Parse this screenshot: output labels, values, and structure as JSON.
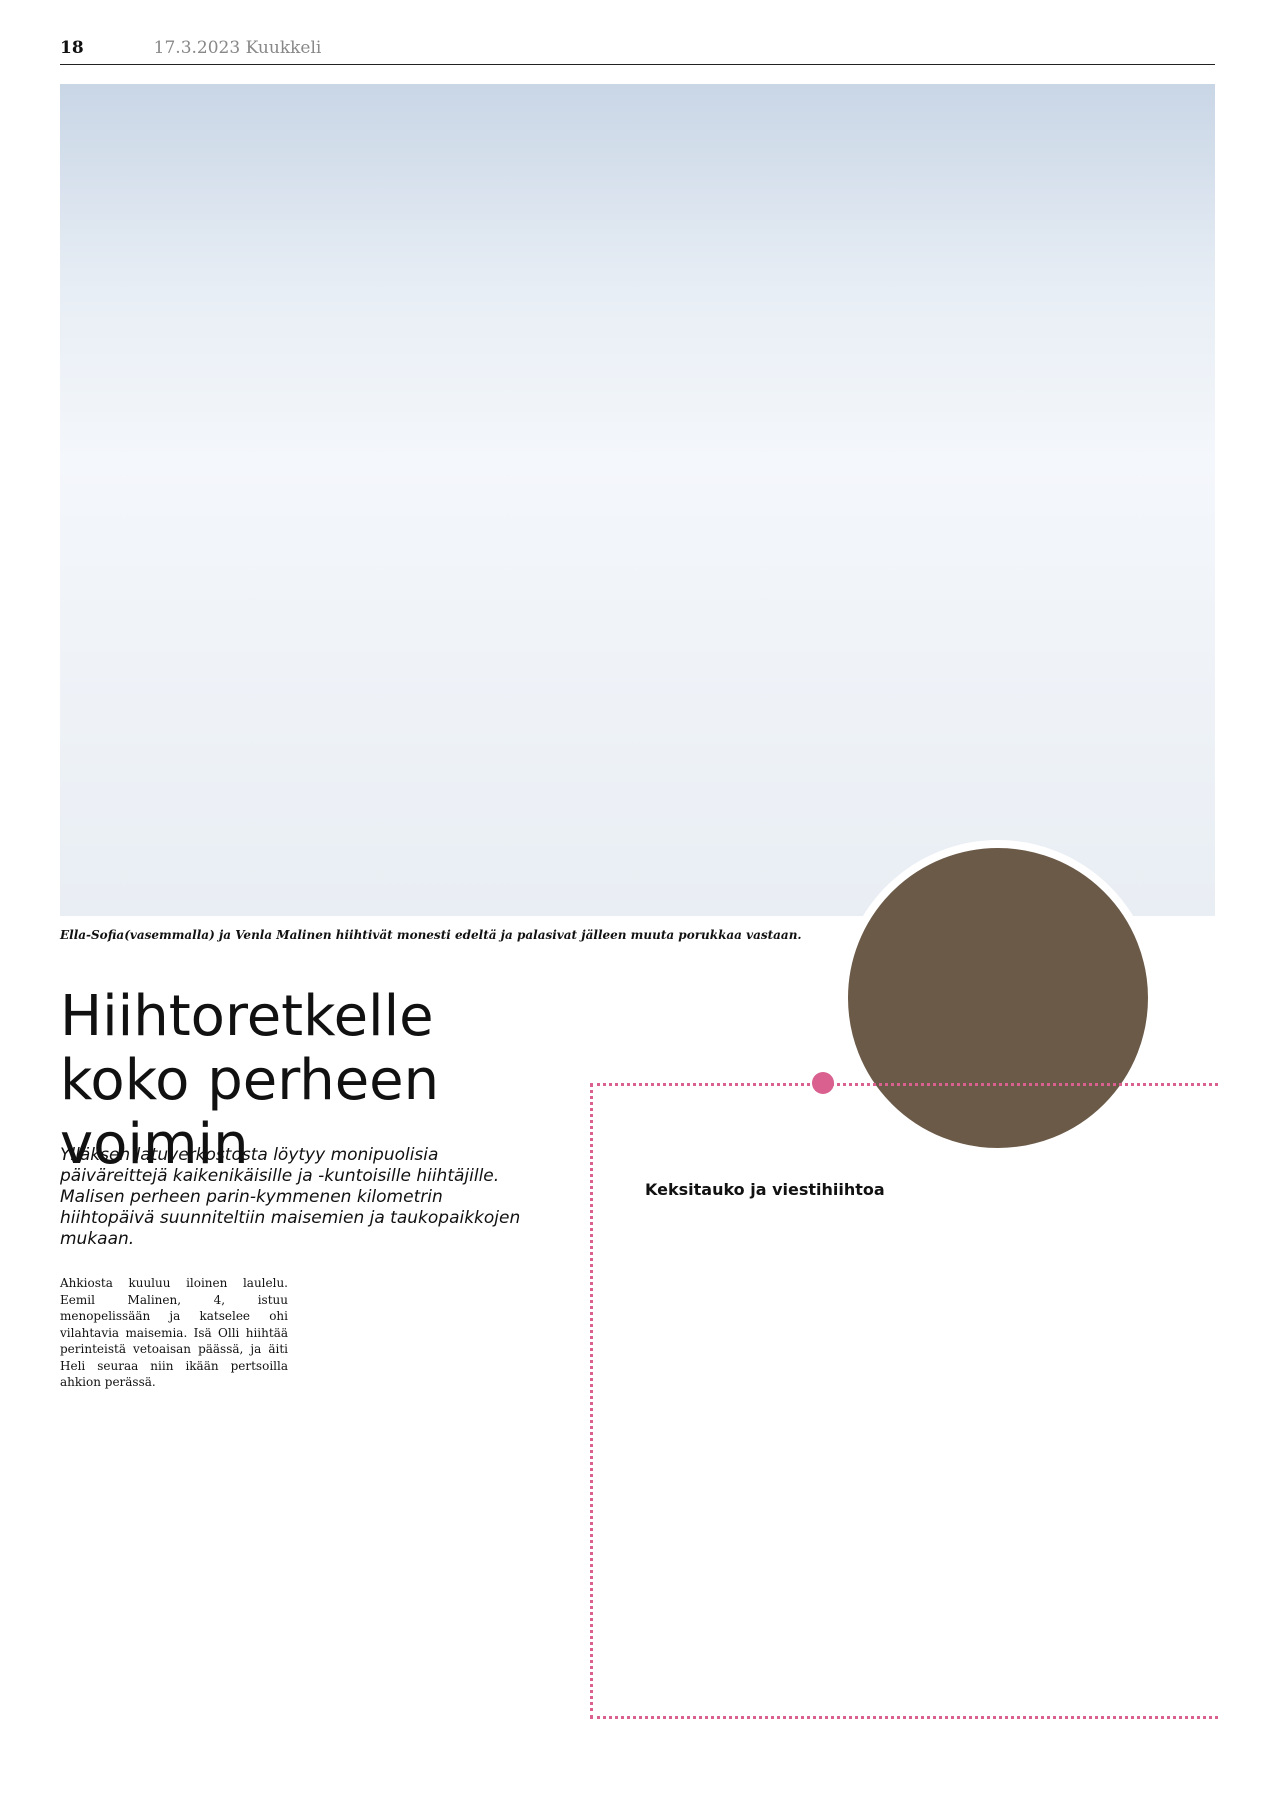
{
  "header": {
    "page": "18",
    "date": "17.3.2023 Kuukkeli"
  },
  "caption": "Ella-Sofia(vasemmalla) ja Venla Malinen hiihtivät monesti edeltä ja palasivat jälleen muuta porukkaa vastaan.",
  "title": "Hiihtoretkelle koko perheen voimin",
  "lead": "Ylläksen latuverkostosta löytyy monipuolisia päiväreittejä kaikenikäisille ja -kuntoisille hiihtäjille. Malisen perheen parin-kymmenen kilometrin hiihtopäivä suunniteltiin maisemien ja taukopaikkojen mukaan.",
  "subhead": "Keksitauko ja viestihiihtoa",
  "col1": "Ahkiosta kuuluu iloinen laulelu. Eemil Malinen, 4, istuu menopelissään ja katselee ohi vilahtavia maisemia. Isä Olli hiihtää perinteistä vetoaisan päässä, ja äiti Heli seuraa niin ikään pertsoilla ahkion perässä."
}
